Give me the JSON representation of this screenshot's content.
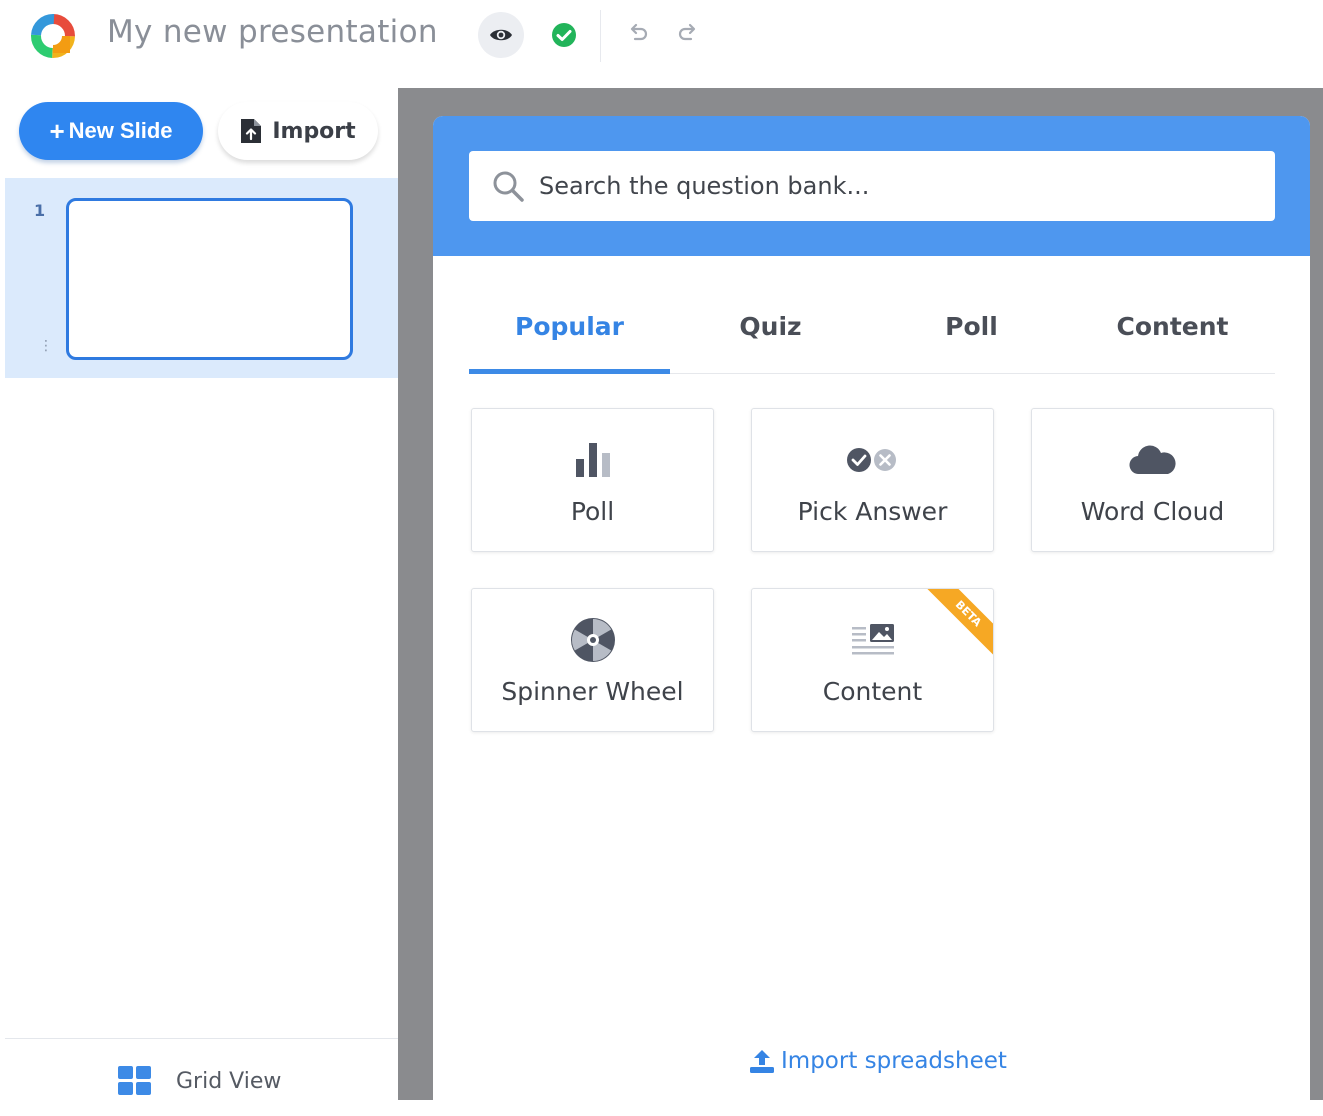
{
  "header": {
    "title": "My new presentation",
    "logo_icon": "app-logo-icon",
    "preview_icon": "eye-icon",
    "saved_icon": "check-circle-icon",
    "undo_icon": "undo-icon",
    "redo_icon": "redo-icon",
    "colors": {
      "title": "#8a8f98",
      "saved": "#22b45a"
    }
  },
  "sidebar": {
    "new_slide_plus": "+",
    "new_slide_label": "New Slide",
    "import_label": "Import",
    "slides": [
      {
        "number": "1",
        "handle": "⋮"
      }
    ],
    "grid_view_label": "Grid View",
    "colors": {
      "accent": "#2f86f0",
      "selected_row": "#dbeafc"
    }
  },
  "panel": {
    "search_placeholder": "Search the question bank...",
    "tabs": [
      {
        "label": "Popular",
        "active": true
      },
      {
        "label": "Quiz",
        "active": false
      },
      {
        "label": "Poll",
        "active": false
      },
      {
        "label": "Content",
        "active": false
      }
    ],
    "cards": [
      {
        "label": "Poll",
        "icon": "bar-chart-icon"
      },
      {
        "label": "Pick Answer",
        "icon": "check-x-icon"
      },
      {
        "label": "Word Cloud",
        "icon": "cloud-icon"
      },
      {
        "label": "Spinner Wheel",
        "icon": "spinner-wheel-icon"
      },
      {
        "label": "Content",
        "icon": "content-icon",
        "badge": "BETA"
      }
    ],
    "import_spreadsheet_label": "Import spreadsheet",
    "colors": {
      "header": "#4e97ef",
      "active_tab": "#3584e4",
      "beta_badge": "#f6a824"
    }
  }
}
